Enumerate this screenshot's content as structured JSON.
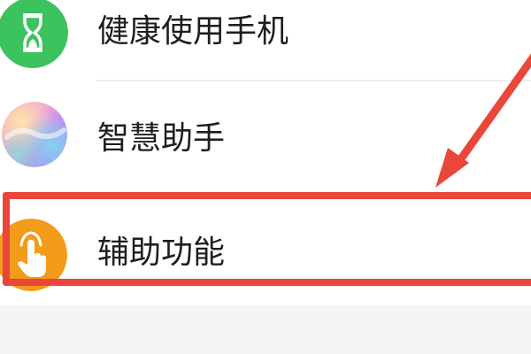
{
  "settings_list": {
    "items": [
      {
        "label": "健康使用手机",
        "icon": "hourglass-icon",
        "icon_color": "#3cc35d"
      },
      {
        "label": "智慧助手",
        "icon": "smart-assistant-icon",
        "icon_color": "#c98be8"
      },
      {
        "label": "辅助功能",
        "icon": "hand-tap-icon",
        "icon_color": "#f39b1b"
      }
    ]
  },
  "annotation": {
    "highlight_color": "#e9473a",
    "highlighted_item": "辅助功能"
  }
}
